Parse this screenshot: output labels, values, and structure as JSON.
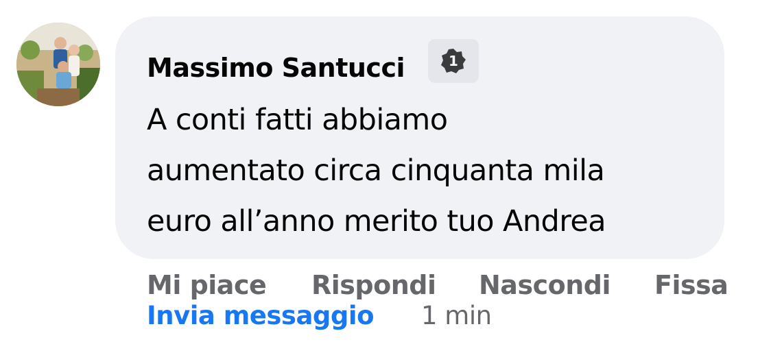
{
  "comment": {
    "author": "Massimo Santucci",
    "badge_count": "1",
    "text": "A conti fatti abbiamo\naumentato circa cinquanta mila\neuro all’anno merito tuo Andrea"
  },
  "actions": {
    "like": "Mi piace",
    "reply": "Rispondi",
    "hide": "Nascondi",
    "pin": "Fissa",
    "send_message": "Invia messaggio",
    "timestamp": "1 min"
  },
  "icons": {
    "avatar": "profile-photo",
    "badge": "rank-badge-icon"
  },
  "colors": {
    "bubble": "#f0f2f5",
    "link": "#1877f2",
    "secondary_text": "#65676b",
    "primary_text": "#050505"
  }
}
